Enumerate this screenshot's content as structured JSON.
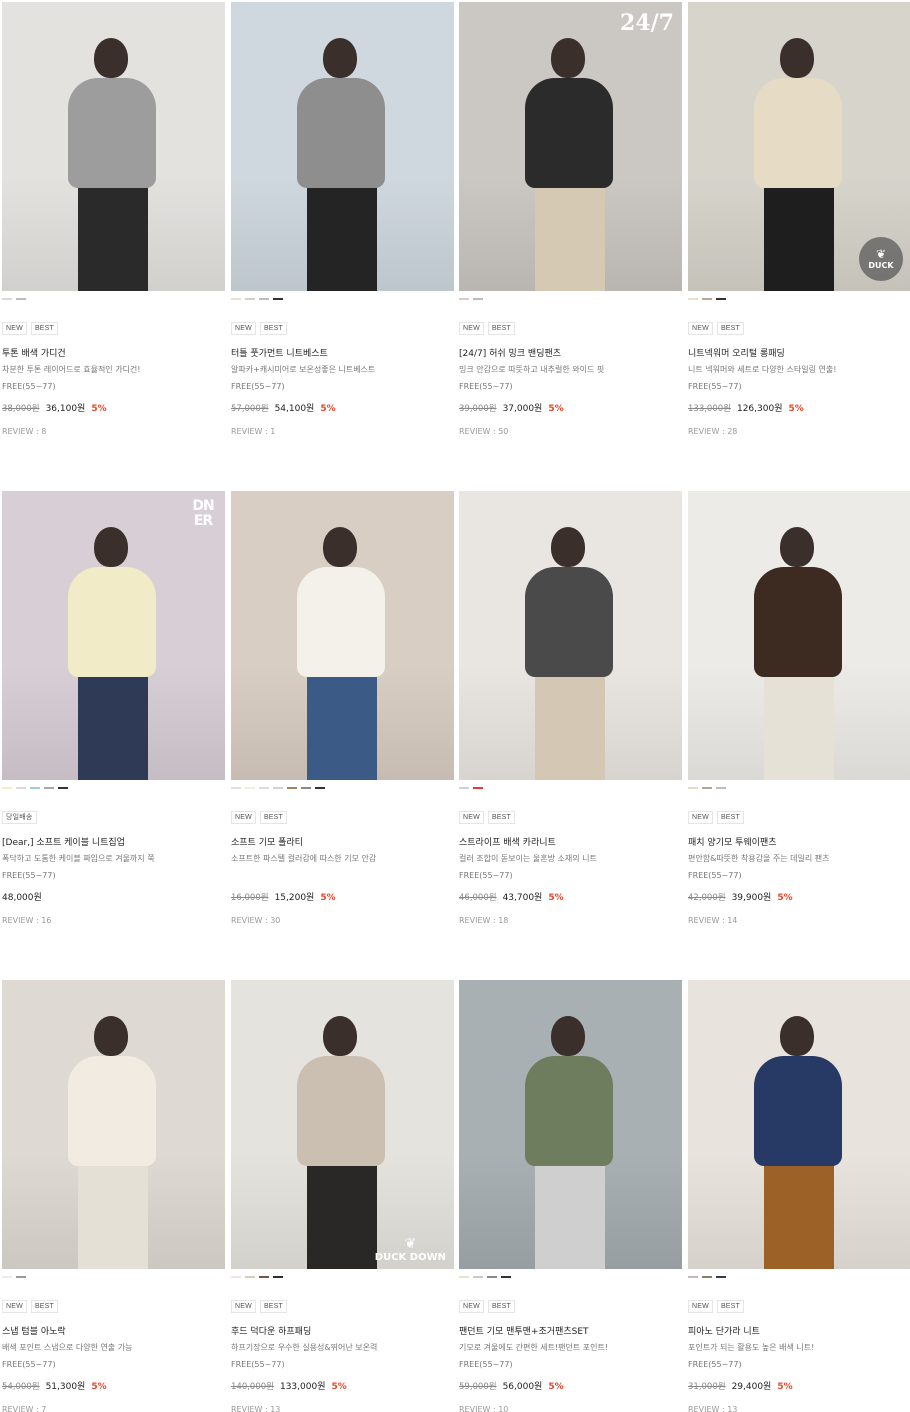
{
  "products": [
    {
      "swatches": [
        "#d9d9d9",
        "#bcbcbc"
      ],
      "tags": [
        "NEW",
        "BEST"
      ],
      "name": "투톤 배색 가디건",
      "desc": "차분한 투톤 레이어드로 효율적인 가디건!",
      "size": "FREE(55~77)",
      "price_old": "38,000원",
      "price_new": "36,100원",
      "discount": "5%",
      "review": "REVIEW : 8",
      "image": {
        "bg": "#e4e2df",
        "top": "#9d9d9d",
        "bottom": "#2a2a2a",
        "icon": "cardigan-photo"
      }
    },
    {
      "swatches": [
        "#e8e0d4",
        "#d6cfc4",
        "#bdbdbd",
        "#333333"
      ],
      "tags": [
        "NEW",
        "BEST"
      ],
      "name": "터틀 풋가먼트 니트베스트",
      "desc": "알파카+캐시미어로 보온성좋은 니트베스트",
      "size": "FREE(55~77)",
      "price_old": "57,000원",
      "price_new": "54,100원",
      "discount": "5%",
      "review": "REVIEW : 1",
      "image": {
        "bg": "#cfd8de",
        "top": "#8e8e8e",
        "bottom": "#242424",
        "icon": "knit-vest-photo"
      }
    },
    {
      "swatches": [
        "#e3c9c9",
        "#bcbcbc"
      ],
      "tags": [
        "NEW",
        "BEST"
      ],
      "name": "[24/7] 허쉬 밍크 밴딩팬츠",
      "desc": "밍크 안감으로 따뜻하고 내추럴한 와이드 핏",
      "size": "FREE(55~77)",
      "price_old": "39,000원",
      "price_new": "37,000원",
      "discount": "5%",
      "review": "REVIEW : 50",
      "image": {
        "bg": "#cbc8c3",
        "top": "#2b2b2b",
        "bottom": "#d6c9b3",
        "icon": "pants-photo",
        "mark": "24/7"
      }
    },
    {
      "swatches": [
        "#eadfca",
        "#b8a88c",
        "#333333"
      ],
      "tags": [
        "NEW",
        "BEST"
      ],
      "name": "니트넥워머 오리털 롱패딩",
      "desc": "니트 넥워머와 세트로 다양한 스타일링 연출!",
      "size": "FREE(55~77)",
      "price_old": "133,000원",
      "price_new": "126,300원",
      "discount": "5%",
      "review": "REVIEW : 28",
      "image": {
        "bg": "#d7d4cc",
        "top": "#e6dcc6",
        "bottom": "#1e1e1e",
        "icon": "long-padding-photo",
        "badge": "DUCK"
      }
    },
    {
      "swatches": [
        "#f3ecc9",
        "#d9d9d9",
        "#9ad0d8",
        "#a9a9a9",
        "#333333"
      ],
      "tags": [
        "당일배송"
      ],
      "name": "[Dear,] 소프트 케이블 니트집업",
      "desc": "폭닥하고 도톰한 케이블 짜임으로 겨울까지 쭉",
      "size": "FREE(55~77)",
      "price_old": "",
      "price_new": "48,000원",
      "discount": "",
      "review": "REVIEW : 16",
      "image": {
        "bg": "#d8cfd6",
        "top": "#f2ebc7",
        "bottom": "#2e3a56",
        "icon": "knit-zipup-photo",
        "logo": "DN ER"
      }
    },
    {
      "swatches": [
        "#e0e0e0",
        "#f1ede2",
        "#dcdcdc",
        "#d2d2d2",
        "#a7835a",
        "#888888",
        "#333333"
      ],
      "tags": [
        "NEW",
        "BEST"
      ],
      "name": "소프트 기모 폴라티",
      "desc": "소프트한 파스텔 컬러감에 따스한 기모 안감",
      "size": "",
      "price_old": "16,000원",
      "price_new": "15,200원",
      "discount": "5%",
      "review": "REVIEW : 30",
      "image": {
        "bg": "#d9cec3",
        "top": "#f4f1ea",
        "bottom": "#3b5a86",
        "icon": "polar-tee-photo"
      }
    },
    {
      "swatches": [
        "#d0d0d0",
        "#e23b3b"
      ],
      "tags": [
        "NEW",
        "BEST"
      ],
      "name": "스트라이프 배색 카라니트",
      "desc": "컬러 조합이 돋보이는 울혼방 소재의 니트",
      "size": "FREE(55~77)",
      "price_old": "46,000원",
      "price_new": "43,700원",
      "discount": "5%",
      "review": "REVIEW : 18",
      "image": {
        "bg": "#e9e6e1",
        "top": "#4a4a4a",
        "bottom": "#d4c7b3",
        "icon": "stripe-knit-photo"
      }
    },
    {
      "swatches": [
        "#e5dcc8",
        "#b0a79a",
        "#bcbcbc"
      ],
      "tags": [
        "NEW",
        "BEST"
      ],
      "name": "패치 양기모 투웨이팬츠",
      "desc": "편안함&따뜻한 착용감을 주는 데일리 팬츠",
      "size": "FREE(55~77)",
      "price_old": "42,000원",
      "price_new": "39,900원",
      "discount": "5%",
      "review": "REVIEW : 14",
      "image": {
        "bg": "#ecebe7",
        "top": "#3d2b22",
        "bottom": "#e6e1d6",
        "icon": "twoway-pants-photo"
      }
    },
    {
      "swatches": [
        "#ececec",
        "#9a9a9a"
      ],
      "tags": [
        "NEW",
        "BEST"
      ],
      "name": "스냅 텀블 아노락",
      "desc": "배색 포인트 스냅으로 다양한 연출 가능",
      "size": "FREE(55~77)",
      "price_old": "54,000원",
      "price_new": "51,300원",
      "discount": "5%",
      "review": "REVIEW : 7",
      "image": {
        "bg": "#dedad3",
        "top": "#f1ebe1",
        "bottom": "#e5e0d6",
        "icon": "anorak-photo"
      }
    },
    {
      "swatches": [
        "#ece9e1",
        "#d6cdbd",
        "#6b5a48",
        "#2c2c2c"
      ],
      "tags": [
        "NEW",
        "BEST"
      ],
      "name": "후드 덕다운 하프패딩",
      "desc": "하프기장으로 우수한 실용성&뛰어난 보온력",
      "size": "FREE(55~77)",
      "price_old": "140,000원",
      "price_new": "133,000원",
      "discount": "5%",
      "review": "REVIEW : 13",
      "image": {
        "bg": "#e5e3de",
        "top": "#cbbfb2",
        "bottom": "#2a2826",
        "icon": "hood-padding-photo",
        "badge": "DUCK DOWN"
      }
    },
    {
      "swatches": [
        "#e9e2c7",
        "#c9c9d2",
        "#8a8a8a",
        "#333333"
      ],
      "tags": [
        "NEW",
        "BEST"
      ],
      "name": "팬던트 기모 맨투맨+조거팬츠SET",
      "desc": "기모로 겨울에도 간편한 세트!팬던트 포인트!",
      "size": "FREE(55~77)",
      "price_old": "59,000원",
      "price_new": "56,000원",
      "discount": "5%",
      "review": "REVIEW : 10",
      "image": {
        "bg": "#a9b0b3",
        "top": "#6e7d5e",
        "bottom": "#cfcfcf",
        "icon": "set-photo"
      }
    },
    {
      "swatches": [
        "#bdbdbd",
        "#8e7b63",
        "#333a56"
      ],
      "tags": [
        "NEW",
        "BEST"
      ],
      "name": "피아노 단가라 니트",
      "desc": "포인트가 되는 활용도 높은 배색 니트!",
      "size": "FREE(55~77)",
      "price_old": "31,000원",
      "price_new": "29,400원",
      "discount": "5%",
      "review": "REVIEW : 13",
      "image": {
        "bg": "#e8e4dd",
        "top": "#273a66",
        "bottom": "#9c6127",
        "icon": "stripe-knit-photo"
      }
    }
  ]
}
